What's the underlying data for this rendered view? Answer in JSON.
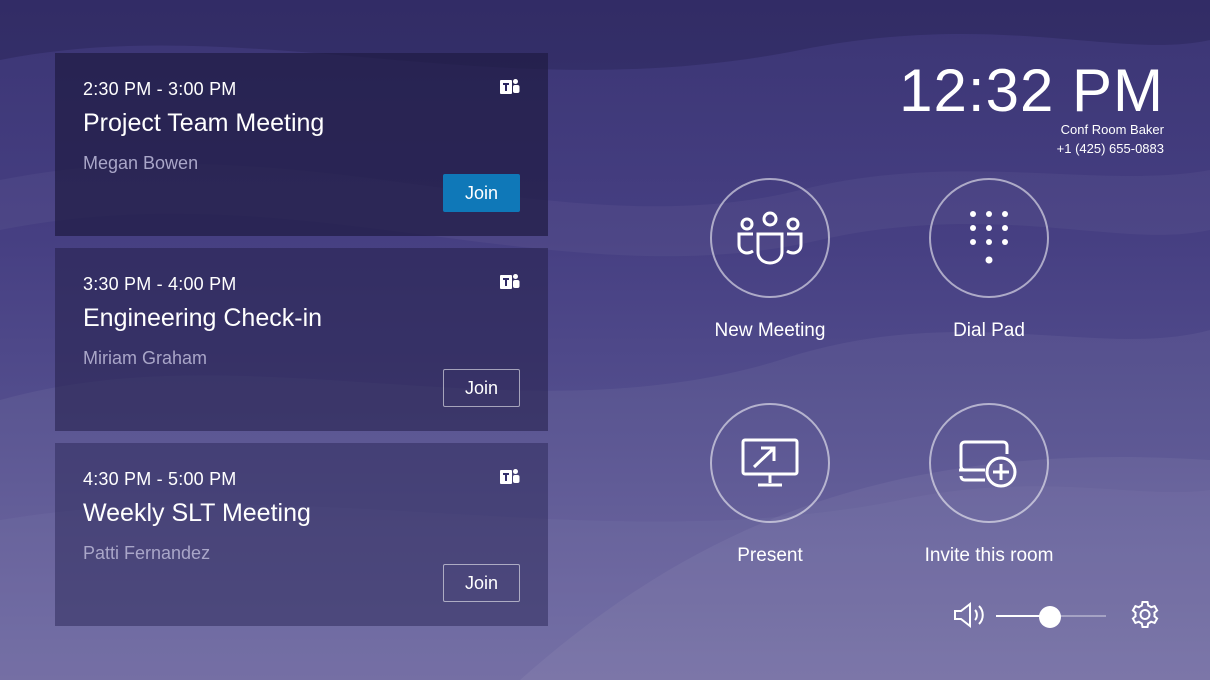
{
  "meetings": [
    {
      "time": "2:30 PM - 3:00 PM",
      "title": "Project Team Meeting",
      "organizer": "Megan Bowen",
      "join_label": "Join",
      "join_style": "primary"
    },
    {
      "time": "3:30 PM - 4:00 PM",
      "title": "Engineering Check-in",
      "organizer": "Miriam Graham",
      "join_label": "Join",
      "join_style": "outline"
    },
    {
      "time": "4:30 PM - 5:00 PM",
      "title": "Weekly SLT Meeting",
      "organizer": "Patti Fernandez",
      "join_label": "Join",
      "join_style": "outline"
    }
  ],
  "header": {
    "clock": "12:32 PM",
    "room_name": "Conf Room Baker",
    "room_phone": "+1 (425) 655-0883"
  },
  "actions": [
    {
      "label": "New Meeting",
      "icon": "people-group-icon"
    },
    {
      "label": "Dial Pad",
      "icon": "dial-pad-icon"
    },
    {
      "label": "Present",
      "icon": "screen-share-icon"
    },
    {
      "label": "Invite this room",
      "icon": "add-device-icon"
    }
  ],
  "controls": {
    "volume_level": 0.49,
    "volume_icon": "speaker-icon",
    "settings_icon": "gear-icon"
  },
  "colors": {
    "join_primary": "#0f78b8",
    "background_top": "#3b3574",
    "background_bottom": "#6a649e",
    "organizer_text": "#a9a6c8"
  }
}
